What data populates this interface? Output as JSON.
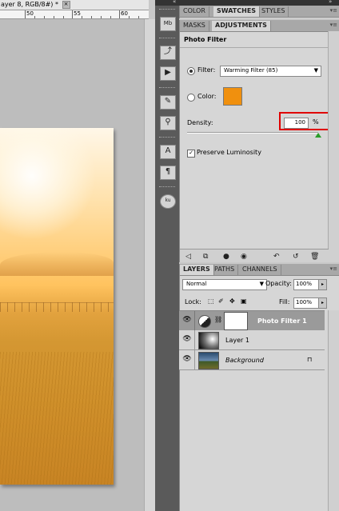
{
  "document": {
    "tab_title": "ayer 8, RGB/8#) *",
    "close_symbol": "×",
    "ruler_numbers": [
      "50",
      "55",
      "60"
    ]
  },
  "collapse_bar": {
    "left_arrows": "«",
    "right_arrows": "»"
  },
  "swatches_panel": {
    "tabs": [
      "COLOR",
      "SWATCHES",
      "STYLES"
    ],
    "active_tab": "SWATCHES"
  },
  "adjustments_panel": {
    "tabs": [
      "MASKS",
      "ADJUSTMENTS"
    ],
    "active_tab": "ADJUSTMENTS",
    "title": "Photo Filter",
    "filter_label": "Filter:",
    "filter_value": "Warming Filter (85)",
    "color_label": "Color:",
    "color_value": "#f0900e",
    "density_label": "Density:",
    "density_value": "100",
    "density_unit": "%",
    "density_level": 1.0,
    "preserve_label": "Preserve Luminosity",
    "preserve_checked": true,
    "highlight_color": "#e00000"
  },
  "layers_panel": {
    "tabs": [
      "LAYERS",
      "PATHS",
      "CHANNELS"
    ],
    "active_tab": "LAYERS",
    "blend_mode": "Normal",
    "opacity_label": "Opacity:",
    "opacity_value": "100%",
    "lock_label": "Lock:",
    "fill_label": "Fill:",
    "fill_value": "100%",
    "layers": [
      {
        "name": "Photo Filter 1",
        "selected": true,
        "type": "adjustment"
      },
      {
        "name": "Layer 1",
        "selected": false,
        "type": "pixel"
      },
      {
        "name": "Background",
        "selected": false,
        "type": "background",
        "locked": true
      }
    ]
  },
  "dock_icons": [
    "mini-bridge-icon",
    "history-icon",
    "actions-icon",
    "brush-icon",
    "clone-source-icon",
    "character-icon",
    "paragraph-icon",
    "kuler-icon"
  ],
  "icons": {
    "eye": "👁",
    "menu": "▾≡",
    "caret": "▼",
    "lock_glyph": "🔒",
    "check": "✓",
    "percent": "%"
  }
}
